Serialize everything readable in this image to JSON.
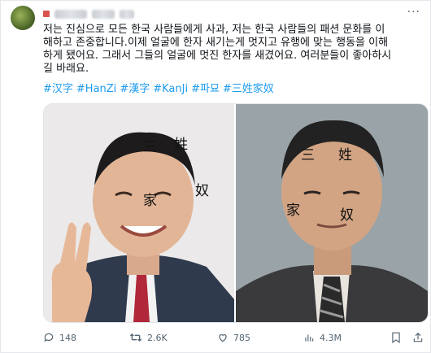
{
  "tweet": {
    "body_lines": [
      "저는 진심으로 모든 한국 사람들에게 사과, 저는 한국 사람들의 패션 문화를 이",
      "해하고 존중합니다.이제 얼굴에 한자 새기는게 멋지고 유행에 맞는 행동을 이해",
      "하게 됐어요. 그래서 그들의 얼굴에 멋진 한자를 새겼어요. 여러분들이 좋아하시",
      "길 바래요."
    ],
    "hashtags": [
      "#汉字",
      "#HanZi",
      "#漢字",
      "#KanJi",
      "#파묘",
      "#三姓家奴"
    ],
    "more_label": "···"
  },
  "media": {
    "left": {
      "hanja": [
        "三",
        "姓",
        "家",
        "奴"
      ]
    },
    "right": {
      "hanja": [
        "三",
        "姓",
        "家",
        "奴"
      ]
    }
  },
  "actions": {
    "reply_count": "148",
    "retweet_count": "2.6K",
    "like_count": "785",
    "views_count": "4.3M"
  },
  "icons": {
    "reply": "reply-icon",
    "retweet": "retweet-icon",
    "like": "heart-icon",
    "views": "views-chart-icon",
    "bookmark": "bookmark-icon",
    "share": "share-icon"
  },
  "colors": {
    "hashtag": "#1d9bf0",
    "text": "#0f1419",
    "muted": "#536471"
  }
}
